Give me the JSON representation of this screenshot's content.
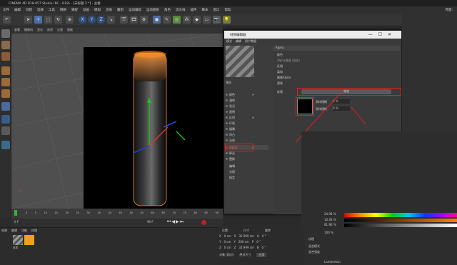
{
  "app": {
    "title": "CINEMA 4D R18.057 Studio (RC - R18) - [未标题 2 *] - 主要"
  },
  "menu": [
    "文件",
    "编辑",
    "创建",
    "选择",
    "工具",
    "网格",
    "捕捉",
    "动画",
    "模拟",
    "渲染",
    "雕刻",
    "运动跟踪",
    "运动图形",
    "角色",
    "流水线",
    "插件",
    "脚本",
    "窗口",
    "帮助"
  ],
  "menu_right": [
    "界面:",
    "启动"
  ],
  "viewport_menu": [
    "查看",
    "摄像机",
    "显示",
    "选项",
    "过滤",
    "面板"
  ],
  "toolbar_xyz": [
    "X",
    "Y",
    "Z"
  ],
  "dialog": {
    "title": "材质编辑器",
    "menu": [
      "模式",
      "编辑",
      "用户数据"
    ],
    "section": "Alpha",
    "fields": [
      "颜色",
      "Alpha通道 (双面)",
      "反相",
      "柔和",
      "图像Alpha",
      "预乘"
    ],
    "texture_label": "纹理",
    "texture_value": "噪波",
    "scale_label1": "采样模糊",
    "scale_val1": "0 %",
    "scale_label2": "采样模糊",
    "scale_val2": "0 %",
    "channels": [
      "颜色",
      "漫射",
      "发光",
      "透明",
      "反射",
      "环境",
      "烟雾",
      "凹凸",
      "法线",
      "Alpha",
      "辉光",
      "置换",
      "编辑",
      "光照",
      "指定"
    ],
    "preview_label": "预览"
  },
  "timeline": {
    "frames": [
      "0",
      "5",
      "10",
      "15",
      "20",
      "25",
      "30",
      "35",
      "40",
      "45",
      "50",
      "55",
      "60",
      "65",
      "70",
      "75",
      "80",
      "85",
      "90"
    ],
    "end": "90 F",
    "start": "0 F"
  },
  "coords": {
    "headers": [
      "位置",
      "尺寸",
      "旋转"
    ],
    "rows": [
      [
        "X",
        "0 cm",
        "X",
        "32.999 cm",
        "H",
        "0 °"
      ],
      [
        "Y",
        "0 cm",
        "Y",
        "200 cm",
        "P",
        "0 °"
      ],
      [
        "Z",
        "0 cm",
        "Z",
        "32.999 cm",
        "B",
        "0 °"
      ]
    ],
    "mode": "对象 (相对)",
    "size_mode": "绝对尺寸",
    "apply": "应用"
  },
  "material": {
    "menu": [
      "创建",
      "编辑",
      "功能",
      "纹理"
    ],
    "item": "材质"
  },
  "attr": {
    "rows": [
      "R",
      "G",
      "B"
    ],
    "values": [
      "24.98 %",
      "10.48 %",
      "81.96 %"
    ],
    "brightness": "100 %",
    "label_tex": "纹理",
    "mix_mode": "混合模式",
    "mix_str": "混合强度",
    "model": "Lambertian"
  },
  "colors": {
    "accent": "#ff8a1e",
    "red": "#e02020"
  }
}
